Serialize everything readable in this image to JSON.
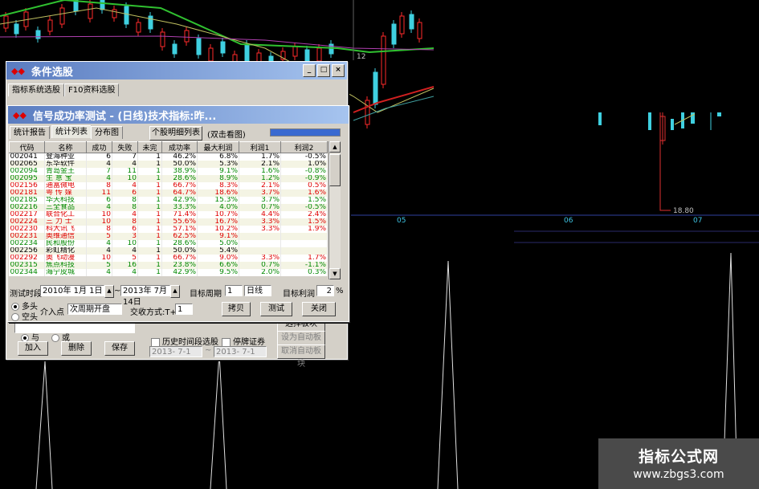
{
  "chart": {
    "axis_dates": [
      "05",
      "06",
      "07"
    ],
    "price_marker": "18.80",
    "price_axis_num": "12"
  },
  "watermark": {
    "line1": "指标公式网",
    "line2": "www.zbgs3.com"
  },
  "cond_window": {
    "title": "条件选股",
    "tabs": [
      "指标系统选股",
      "F10资料选股"
    ],
    "logic": {
      "and_label": "与",
      "or_label": "或"
    },
    "buttons": {
      "add": "加入",
      "delete": "删除",
      "save": "保存",
      "select_block": "选择板块",
      "set_auto": "设为自动板块",
      "cancel_auto": "取消自动板块"
    },
    "history_label": "历史时间段选股",
    "suspend_label": "停牌证券",
    "date_from": "2013- 7-1",
    "date_to": "2013- 7-1"
  },
  "signal_window": {
    "title": "信号成功率测试 - (日线)技术指标:昨...",
    "tabs": [
      "统计报告",
      "统计列表",
      "分布图"
    ],
    "detail_button": "个股明细列表",
    "detail_hint": "(双击看图)",
    "columns": [
      "代码",
      "名称",
      "成功",
      "失败",
      "未完",
      "成功率",
      "最大利润",
      "利润1",
      "利润2"
    ],
    "rows": [
      {
        "code": "002041",
        "name": "登海种业",
        "s": "6",
        "f": "7",
        "u": "1",
        "rate": "46.2%",
        "max": "6.8%",
        "p1": "1.7%",
        "p2": "-0.5%",
        "c": "nt"
      },
      {
        "code": "002065",
        "name": "东华软件",
        "s": "4",
        "f": "4",
        "u": "1",
        "rate": "50.0%",
        "max": "5.3%",
        "p1": "2.1%",
        "p2": "1.0%",
        "c": "nt"
      },
      {
        "code": "002094",
        "name": "青岛金王",
        "s": "7",
        "f": "11",
        "u": "1",
        "rate": "38.9%",
        "max": "9.1%",
        "p1": "1.6%",
        "p2": "-0.8%",
        "c": "dn"
      },
      {
        "code": "002095",
        "name": "生 意 宝",
        "s": "4",
        "f": "10",
        "u": "1",
        "rate": "28.6%",
        "max": "8.9%",
        "p1": "1.2%",
        "p2": "-0.9%",
        "c": "dn"
      },
      {
        "code": "002156",
        "name": "通富微电",
        "s": "8",
        "f": "4",
        "u": "1",
        "rate": "66.7%",
        "max": "8.3%",
        "p1": "2.1%",
        "p2": "0.5%",
        "c": "up"
      },
      {
        "code": "002181",
        "name": "粤 传 媒",
        "s": "11",
        "f": "6",
        "u": "1",
        "rate": "64.7%",
        "max": "18.6%",
        "p1": "3.7%",
        "p2": "1.6%",
        "c": "up"
      },
      {
        "code": "002185",
        "name": "华天科技",
        "s": "6",
        "f": "8",
        "u": "1",
        "rate": "42.9%",
        "max": "15.3%",
        "p1": "3.7%",
        "p2": "1.5%",
        "c": "dn"
      },
      {
        "code": "002216",
        "name": "三全食品",
        "s": "4",
        "f": "8",
        "u": "1",
        "rate": "33.3%",
        "max": "4.0%",
        "p1": "0.7%",
        "p2": "-0.5%",
        "c": "dn"
      },
      {
        "code": "002217",
        "name": "联合化工",
        "s": "10",
        "f": "4",
        "u": "1",
        "rate": "71.4%",
        "max": "10.7%",
        "p1": "4.4%",
        "p2": "2.4%",
        "c": "up"
      },
      {
        "code": "002224",
        "name": "三 力 士",
        "s": "10",
        "f": "8",
        "u": "1",
        "rate": "55.6%",
        "max": "16.7%",
        "p1": "3.3%",
        "p2": "1.5%",
        "c": "up"
      },
      {
        "code": "002230",
        "name": "科大讯飞",
        "s": "8",
        "f": "6",
        "u": "1",
        "rate": "57.1%",
        "max": "10.2%",
        "p1": "3.3%",
        "p2": "1.9%",
        "c": "up"
      },
      {
        "code": "002231",
        "name": "奥维通信",
        "s": "5",
        "f": "3",
        "u": "1",
        "rate": "62.5%",
        "max": "9.1%",
        "p1": "",
        "p2": "",
        "c": "up"
      },
      {
        "code": "002234",
        "name": "民和股份",
        "s": "4",
        "f": "10",
        "u": "1",
        "rate": "28.6%",
        "max": "5.0%",
        "p1": "",
        "p2": "",
        "c": "dn"
      },
      {
        "code": "002256",
        "name": "彩虹精化",
        "s": "4",
        "f": "4",
        "u": "1",
        "rate": "50.0%",
        "max": "5.4%",
        "p1": "",
        "p2": "",
        "c": "nt"
      },
      {
        "code": "002292",
        "name": "奥飞动漫",
        "s": "10",
        "f": "5",
        "u": "1",
        "rate": "66.7%",
        "max": "9.0%",
        "p1": "3.3%",
        "p2": "1.7%",
        "c": "up"
      },
      {
        "code": "002315",
        "name": "焦点科技",
        "s": "5",
        "f": "16",
        "u": "1",
        "rate": "23.8%",
        "max": "6.6%",
        "p1": "0.7%",
        "p2": "-1.1%",
        "c": "dn"
      },
      {
        "code": "002344",
        "name": "海宁皮城",
        "s": "4",
        "f": "4",
        "u": "1",
        "rate": "42.9%",
        "max": "9.5%",
        "p1": "2.0%",
        "p2": "0.3%",
        "c": "dn"
      }
    ],
    "test_period_label": "测试时段",
    "date_start": "2010年 1月 1日",
    "date_end": "2013年 7月14日",
    "target_cycle_label": "目标周期",
    "target_cycle_value": "1",
    "cycle_unit": "日线",
    "target_profit_label": "目标利润",
    "target_profit_value": "2",
    "percent": "%",
    "long_label": "多头",
    "short_label": "空头",
    "entry_label": "介入点",
    "entry_value": "次周期开盘",
    "trade_label": "交收方式:T+",
    "trade_value": "1",
    "copy_button": "拷贝",
    "test_button": "测试",
    "close_button": "关闭"
  }
}
